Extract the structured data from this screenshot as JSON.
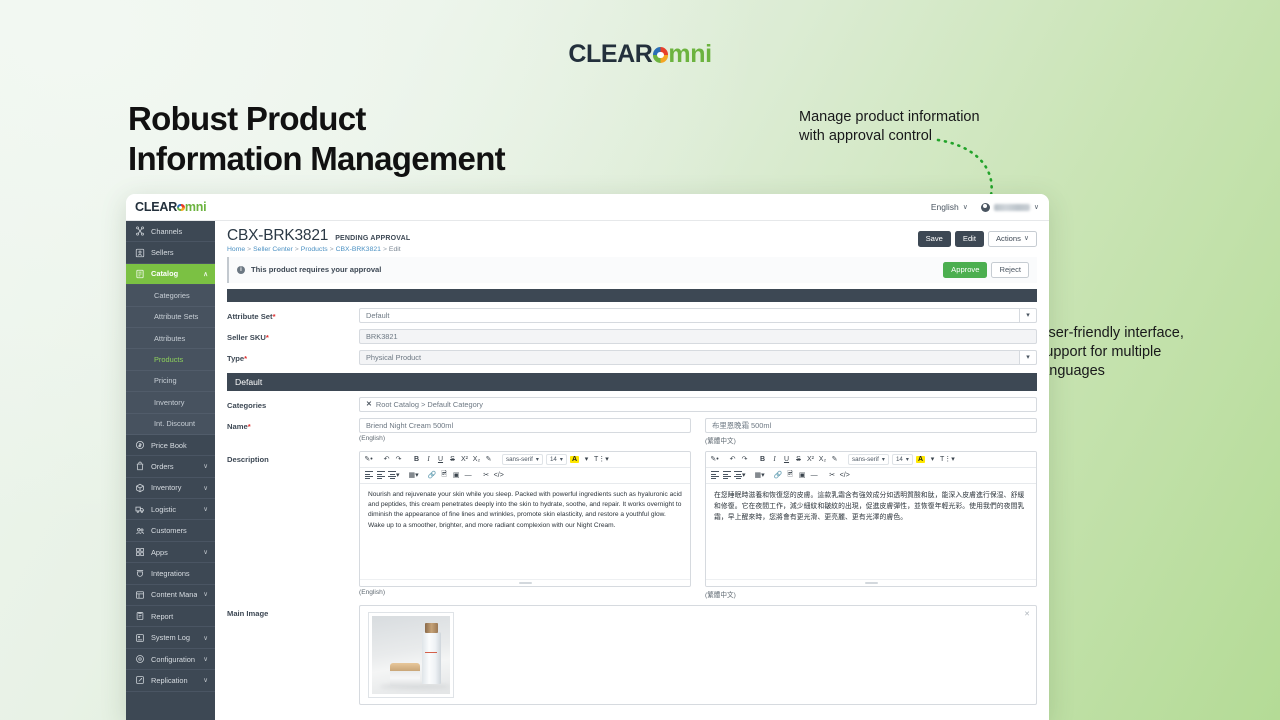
{
  "brand": {
    "part1": "CLEAR",
    "part2": "mni"
  },
  "headline": {
    "line1": "Robust Product",
    "line2": "Information Management"
  },
  "annotations": {
    "top": [
      "Manage product information",
      "with approval control"
    ],
    "right": [
      "User-friendly interface,",
      "support for multiple",
      "languages"
    ]
  },
  "app": {
    "topbar": {
      "language": "English",
      "user_name": "",
      "language_caret": "∨",
      "user_caret": "∨"
    },
    "sidebar": [
      {
        "label": "Channels",
        "icon": "channels-icon",
        "type": "item",
        "chevron": ""
      },
      {
        "label": "Sellers",
        "icon": "sellers-icon",
        "type": "item",
        "chevron": ""
      },
      {
        "label": "Catalog",
        "icon": "catalog-icon",
        "type": "item",
        "active": true,
        "chevron": "∧"
      },
      {
        "label": "Categories",
        "type": "sub"
      },
      {
        "label": "Attribute Sets",
        "type": "sub"
      },
      {
        "label": "Attributes",
        "type": "sub"
      },
      {
        "label": "Products",
        "type": "sub",
        "current": true
      },
      {
        "label": "Pricing",
        "type": "sub"
      },
      {
        "label": "Inventory",
        "type": "sub"
      },
      {
        "label": "Int. Discount",
        "type": "sub"
      },
      {
        "label": "Price Book",
        "icon": "price-book-icon",
        "type": "item",
        "chevron": ""
      },
      {
        "label": "Orders",
        "icon": "orders-icon",
        "type": "item",
        "chevron": "∨"
      },
      {
        "label": "Inventory",
        "icon": "inventory-icon",
        "type": "item",
        "chevron": "∨"
      },
      {
        "label": "Logistic",
        "icon": "logistic-icon",
        "type": "item",
        "chevron": "∨"
      },
      {
        "label": "Customers",
        "icon": "customers-icon",
        "type": "item",
        "chevron": ""
      },
      {
        "label": "Apps",
        "icon": "apps-icon",
        "type": "item",
        "chevron": "∨"
      },
      {
        "label": "Integrations",
        "icon": "integrations-icon",
        "type": "item",
        "chevron": ""
      },
      {
        "label": "Content Manager",
        "icon": "content-manager-icon",
        "type": "item",
        "chevron": "∨"
      },
      {
        "label": "Report",
        "icon": "report-icon",
        "type": "item",
        "chevron": ""
      },
      {
        "label": "System Log",
        "icon": "system-log-icon",
        "type": "item",
        "chevron": "∨"
      },
      {
        "label": "Configuration",
        "icon": "configuration-icon",
        "type": "item",
        "chevron": "∨"
      },
      {
        "label": "Replication",
        "icon": "replication-icon",
        "type": "item",
        "chevron": "∨"
      }
    ],
    "page": {
      "title": "CBX-BRK3821",
      "status_badge": "PENDING APPROVAL",
      "breadcrumb": [
        "Home",
        "Seller Center",
        "Products",
        "CBX-BRK3821",
        "Edit"
      ],
      "buttons": {
        "save": "Save",
        "edit": "Edit",
        "actions": "Actions",
        "actions_caret": "∨"
      },
      "approval": {
        "message": "This product requires your approval",
        "approve": "Approve",
        "reject": "Reject",
        "info_glyph": "i"
      }
    },
    "form": {
      "attribute_set": {
        "label": "Attribute Set",
        "required": true,
        "value": "Default"
      },
      "seller_sku": {
        "label": "Seller SKU",
        "required": true,
        "value": "BRK3821"
      },
      "type": {
        "label": "Type",
        "required": true,
        "value": "Physical Product"
      },
      "section_title": "Default",
      "categories": {
        "label": "Categories",
        "value": "Root Catalog > Default Category",
        "remove_glyph": "✕"
      },
      "name": {
        "label": "Name",
        "required": true,
        "en_value": "Briend Night Cream 500ml",
        "en_caption": "(English)",
        "zh_value": "布里恩晚霜 500ml",
        "zh_caption": "(繁體中文)"
      },
      "description": {
        "label": "Description",
        "en_caption": "(English)",
        "zh_caption": "(繁體中文)",
        "en_value": "Nourish and rejuvenate your skin while you sleep. Packed with powerful ingredients such as hyaluronic acid and peptides, this cream penetrates deeply into the skin to hydrate, soothe, and repair. It works overnight to diminish the appearance of fine lines and wrinkles, promote skin elasticity, and restore a youthful glow. Wake up to a smoother, brighter, and more radiant complexion with our Night Cream.",
        "zh_value": "在您睡眠時滋養和恢復您的皮膚。這款乳霜含有強效成分如透明質酸和肽，能深入皮膚進行保湿、舒緩和修復。它在夜間工作，減少細紋和皺紋的出現，促進皮膚彈性，並恢復年輕光彩。使用我們的夜間乳霜，早上醒來時，您將會有更光滑、更亮麗、更有光澤的膚色。"
      },
      "main_image": {
        "label": "Main Image",
        "close_glyph": "✕"
      }
    },
    "editor_toolbar": {
      "row1": [
        {
          "glyph": "🖌",
          "name": "format-painter-icon"
        },
        {
          "glyph": "↶",
          "name": "undo-icon"
        },
        {
          "glyph": "↷",
          "name": "redo-icon"
        },
        {
          "glyph": "B",
          "name": "bold-icon"
        },
        {
          "glyph": "I",
          "name": "italic-icon"
        },
        {
          "glyph": "U",
          "name": "underline-icon"
        },
        {
          "glyph": "S",
          "name": "strikethrough-icon"
        },
        {
          "glyph": "X²",
          "name": "superscript-icon"
        },
        {
          "glyph": "X₂",
          "name": "subscript-icon"
        },
        {
          "glyph": "✐",
          "name": "clear-format-icon"
        }
      ],
      "font_family": "sans-serif",
      "font_size": "14",
      "highlight": "A",
      "text_color": "T",
      "row2": [
        {
          "glyph": "list-ul",
          "name": "bullet-list-icon"
        },
        {
          "glyph": "list-ol",
          "name": "numbered-list-icon"
        },
        {
          "glyph": "align",
          "name": "align-icon"
        },
        {
          "glyph": "table",
          "name": "table-icon"
        },
        {
          "glyph": "∞",
          "name": "link-icon"
        },
        {
          "glyph": "▣",
          "name": "image-icon"
        },
        {
          "glyph": "▬",
          "name": "video-icon"
        },
        {
          "glyph": "—",
          "name": "horizontal-rule-icon"
        },
        {
          "glyph": "✂",
          "name": "cut-icon"
        },
        {
          "glyph": "</>",
          "name": "source-code-icon"
        }
      ]
    }
  }
}
